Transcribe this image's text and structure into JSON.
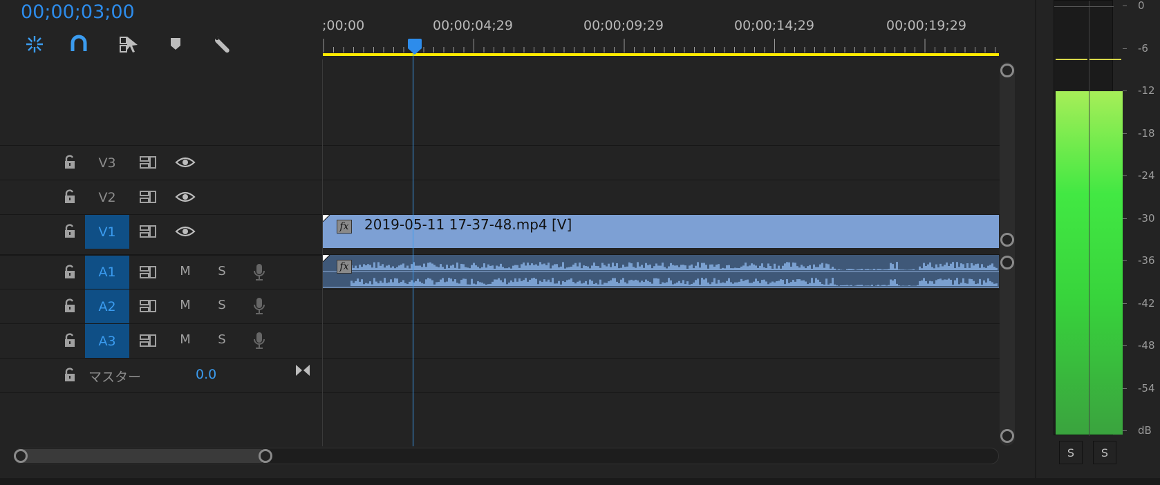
{
  "header": {
    "timecode": "00;00;03;00",
    "tools": [
      "snap-in-sequence-icon",
      "magnet-icon",
      "linked-selection-icon",
      "marker-icon",
      "wrench-icon"
    ]
  },
  "ruler": {
    "labels": [
      ";00;00",
      "00;00;04;29",
      "00;00;09;29",
      "00;00;14;29",
      "00;00;19;29"
    ]
  },
  "tracks": {
    "video": [
      {
        "name": "V3",
        "active": false
      },
      {
        "name": "V2",
        "active": false
      },
      {
        "name": "V1",
        "active": true
      }
    ],
    "audio": [
      {
        "name": "A1",
        "active": true,
        "m": "M",
        "s": "S"
      },
      {
        "name": "A2",
        "active": true,
        "m": "M",
        "s": "S"
      },
      {
        "name": "A3",
        "active": true,
        "m": "M",
        "s": "S"
      }
    ],
    "master": {
      "label": "マスター",
      "value": "0.0"
    }
  },
  "clips": {
    "video": {
      "name": "2019-05-11 17-37-48.mp4 [V]",
      "fx": "fx"
    },
    "audio": {
      "fx": "fx"
    }
  },
  "meters": {
    "db_labels": [
      "0",
      "-6",
      "-12",
      "-18",
      "-24",
      "-30",
      "-36",
      "-42",
      "-48",
      "-54",
      "dB"
    ],
    "left_level_db": -12,
    "right_level_db": -12,
    "solo_left": "S",
    "solo_right": "S"
  },
  "colors": {
    "accent": "#2d8ceb",
    "ruler_work_area": "#ffea00",
    "video_clip": "#7da0d4",
    "audio_clip": "#3f5878",
    "active_track": "#0f4f86"
  }
}
